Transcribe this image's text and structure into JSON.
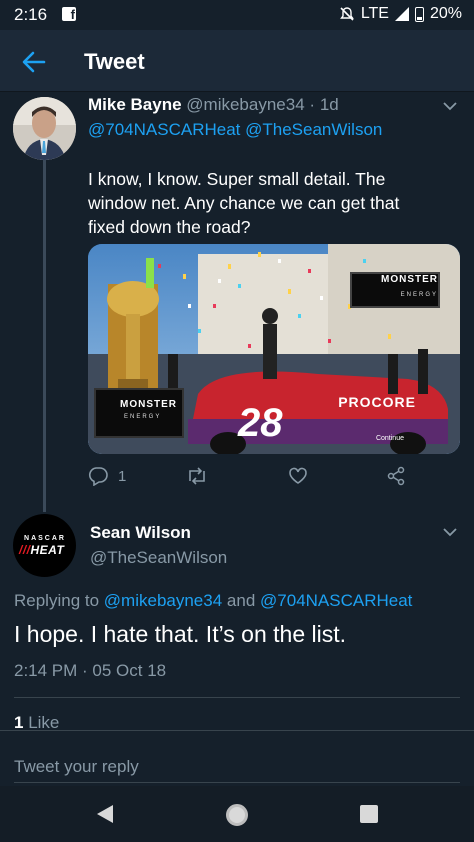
{
  "status_bar": {
    "time": "2:16",
    "network": "LTE",
    "battery": "20%",
    "icons": [
      "facebook-icon",
      "mute-icon",
      "signal-icon",
      "battery-icon"
    ]
  },
  "header": {
    "title": "Tweet",
    "back_icon": "arrow-left-icon"
  },
  "tweet1": {
    "name": "Mike Bayne",
    "handle": "@mikebayne34",
    "separator": "·",
    "time": "1d",
    "mentions": "@704NASCARHeat @TheSeanWilson",
    "text": "I know, I know. Super small detail. The window net. Any chance we can get that fixed down the road?",
    "media": {
      "brand_top": "MONSTER",
      "brand_sub": "ENERGY",
      "brand_bottom": "MONSTER",
      "brand_bottom_sub": "ENERGY",
      "car_number": "28",
      "car_sponsor": "PROCORE",
      "continue_label": "Continue"
    },
    "reply_count": "1"
  },
  "tweet2": {
    "name": "Sean Wilson",
    "handle": "@TheSeanWilson",
    "replying_prefix": "Replying to",
    "replying_user1": "@mikebayne34",
    "replying_and": "and",
    "replying_user2": "@704NASCARHeat",
    "text": "I hope. I hate that. It’s on the list.",
    "meta": "2:14 PM · 05 Oct 18",
    "likes_count": "1",
    "likes_label": "Like",
    "avatar_text_top": "NASCAR",
    "avatar_text_bottom": "HEAT"
  },
  "composer": {
    "placeholder": "Tweet your reply"
  },
  "colors": {
    "background": "#15202b",
    "header": "#1c2938",
    "accent": "#1da1f2",
    "secondary_text": "#8899a6"
  }
}
